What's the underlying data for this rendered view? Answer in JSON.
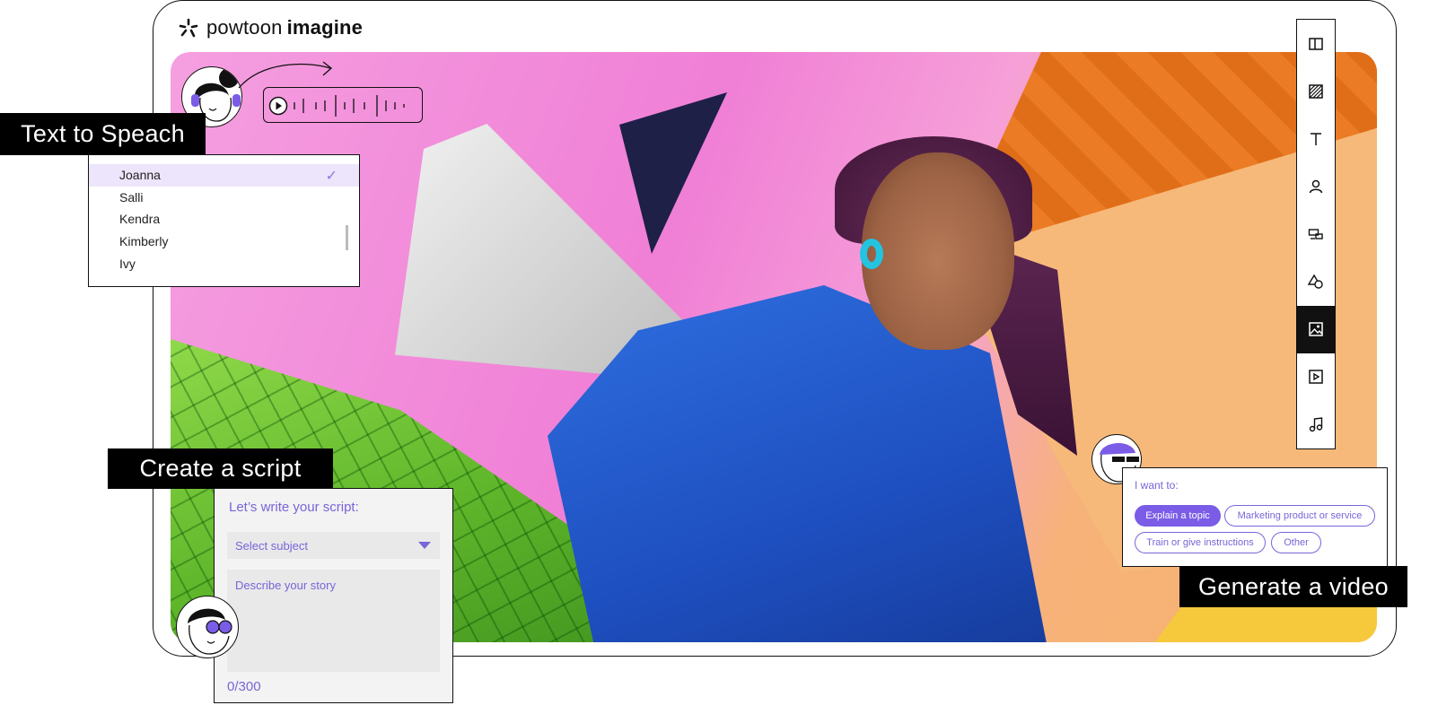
{
  "brand": {
    "word_light": "powtoon",
    "word_bold": "imagine"
  },
  "labels": {
    "text_to_speech": "Text to Speach",
    "create_script": "Create a script",
    "generate_video": "Generate a video"
  },
  "voices": [
    {
      "name": "Joanna",
      "selected": true
    },
    {
      "name": "Salli",
      "selected": false
    },
    {
      "name": "Kendra",
      "selected": false
    },
    {
      "name": "Kimberly",
      "selected": false
    },
    {
      "name": "Ivy",
      "selected": false
    }
  ],
  "script_panel": {
    "title": "Let’s write your script:",
    "subject_placeholder": "Select subject",
    "story_placeholder": "Describe your story",
    "counter": "0/300"
  },
  "want_panel": {
    "title": "I want to:",
    "chips": [
      {
        "label": "Explain a topic",
        "active": true
      },
      {
        "label": "Marketing product or service",
        "active": false
      },
      {
        "label": "Train or give instructions",
        "active": false
      },
      {
        "label": "Other",
        "active": false
      }
    ]
  },
  "toolbar": {
    "tools": [
      {
        "icon": "layout-icon",
        "active": false
      },
      {
        "icon": "background-icon",
        "active": false
      },
      {
        "icon": "text-icon",
        "active": false
      },
      {
        "icon": "character-icon",
        "active": false
      },
      {
        "icon": "props-icon",
        "active": false
      },
      {
        "icon": "shapes-icon",
        "active": false
      },
      {
        "icon": "image-icon",
        "active": true
      },
      {
        "icon": "video-icon",
        "active": false
      },
      {
        "icon": "music-icon",
        "active": false
      }
    ]
  },
  "colors": {
    "accent": "#7a5ce6",
    "selection": "#ece5fb",
    "active_tool": "#111111"
  }
}
